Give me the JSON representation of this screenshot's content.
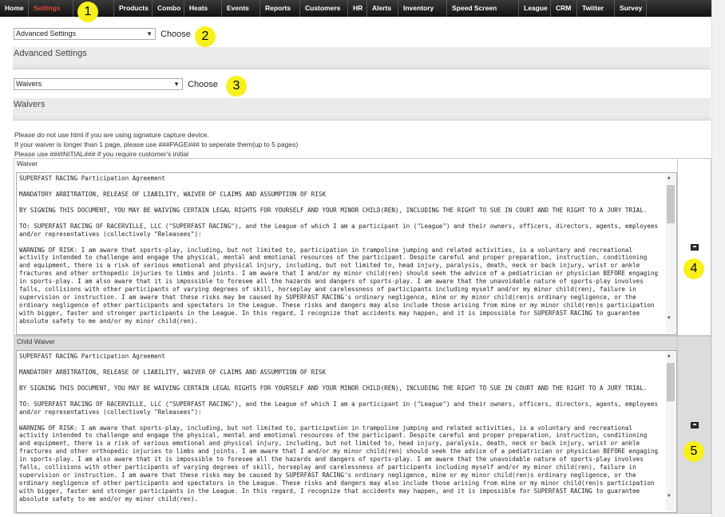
{
  "nav": {
    "items": [
      "Home",
      "Settings",
      "ories",
      "Products",
      "Combo",
      "Heats",
      "Events",
      "Reports",
      "Customers",
      "HR",
      "Alerts",
      "Inventory",
      "Speed Screen",
      "League",
      "CRM",
      "Twitter",
      "Survey"
    ],
    "active": "Settings"
  },
  "settings_select": {
    "value": "Advanced Settings",
    "choose": "Choose"
  },
  "advanced_section": {
    "title": "Advanced Settings"
  },
  "waivers_select": {
    "value": "Waivers",
    "choose": "Choose"
  },
  "waivers_section": {
    "title": "Waivers"
  },
  "help_lines": [
    "Please do not use html if you are using signature capture device.",
    "If your waiver is longer than 1 page, please use ###PAGE### to seperate them(up to 5 pages)",
    "Please use ###INITIAL### if you require customer's initial"
  ],
  "waiver_paragraphs": [
    "SUPERFAST RACING Participation Agreement",
    "MANDATORY ARBITRATION, RELEASE OF LIABILITY, WAIVER OF CLAIMS AND ASSUMPTION OF RISK",
    "BY SIGNING THIS DOCUMENT, YOU MAY BE WAIVING CERTAIN LEGAL RIGHTS FOR YOURSELF AND YOUR MINOR CHILD(REN), INCLUDING THE RIGHT TO SUE IN COURT AND THE RIGHT TO A JURY TRIAL.",
    "TO:     SUPERFAST RACING OF RACERVILLE, LLC (\"SUPERFAST RACING\"), and the League of which I am a participant in (\"League\") and their owners, officers, directors, agents, employees and/or representatives (collectively \"Releasees\"):",
    " WARNING OF RISK:  I am aware that sports-play, including, but not limited to, participation in trampoline jumping and related activities, is a voluntary and recreational activity intended to challenge and engage the physical, mental and emotional resources of the participant. Despite careful and proper preparation, instruction, conditioning and equipment, there is a risk of serious emotional and physical injury, including, but not limited to, head injury, paralysis, death, neck or back injury, wrist or ankle fractures and other orthopedic injuries to limbs and joints. I am aware that I and/or my minor child(ren) should seek the advice of a pediatrician or physician BEFORE engaging in sports-play. I am also aware that it is impossible to foresee all the hazards and dangers of sports-play. I am aware that the unavoidable nature of sports-play involves falls, collisions with other participants of varying degrees of skill, horseplay and carelessness of participants including myself and/or my minor child(ren), failure in supervision or instruction. I am aware that these risks may be caused by SUPERFAST RACING's ordinary negligence, mine or my minor child(ren)s ordinary negligence, or the ordinary negligence of other participants and spectators in the League. These risks and dangers may also include those arising from mine or my minor child(ren)s participation with bigger, faster and stronger participants in the League. In this regard, I recognize that accidents may happen, and it is impossible for SUPERFAST RACING to guarantee absolute safety to me and/or my minor child(ren)."
  ],
  "waiver": {
    "title": "Waiver"
  },
  "child_waiver": {
    "title": "Child Waiver"
  },
  "callouts": [
    "1",
    "2",
    "3",
    "4",
    "5"
  ],
  "colors": {
    "nav_bg": "#1a1a1a",
    "active_nav": "#e0473a",
    "callout": "#f7f01a",
    "section_bg": "#ebebeb",
    "child_bg": "#dcdcdc"
  },
  "icons": {
    "save": "save-icon"
  }
}
